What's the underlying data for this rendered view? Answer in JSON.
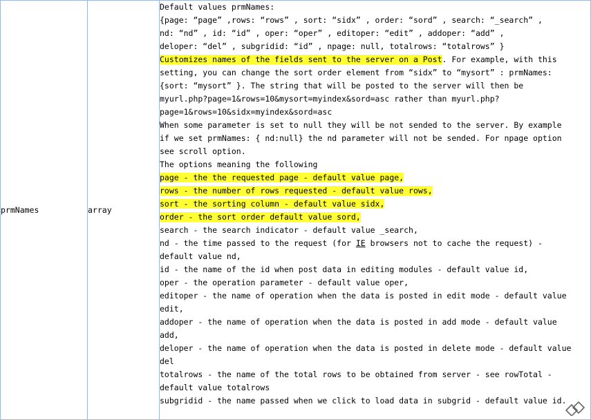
{
  "row": {
    "name": "prmNames",
    "type": "array",
    "description": {
      "default_values": [
        "Default values prmNames:",
        "{page: “page” ,rows: “rows” , sort: “sidx” , order: “sord” , search: “_search” ,",
        "nd: “nd” , id: “id” , oper: “oper” , editoper: “edit” , addoper: “add” ,",
        "deloper: “del” , subgridid: “id” , npage: null, totalrows: “totalrows” }"
      ],
      "customize_highlight": "Customizes names of the fields sent to the server on a Post",
      "customize_rest": ". For example, with this",
      "explain_lines": [
        "setting, you can change the sort order element from  “sidx”  to  “mysort” : prmNames:",
        "{sort:  “mysort” }. The string that will be posted to the server will then be",
        "myurl.php?page=1&rows=10&mysort=myindex&sord=asc rather than myurl.php?",
        "page=1&rows=10&sidx=myindex&sord=asc",
        "When some parameter is set to null they will be not sended to the server. By example",
        "if we set prmNames: { nd:null} the nd parameter will not be sended. For npage option",
        "see scroll option.",
        "The options meaning the following"
      ],
      "highlighted_options": [
        "page - the the requested page - default value page,",
        "rows - the number of rows requested - default value rows,",
        "sort - the sorting column - default value sidx,",
        "order - the sort order default value sord,"
      ],
      "search_line": "search - the search indicator - default value _search,",
      "nd_before": "nd - the time passed to the request (for ",
      "nd_ie": "IE",
      "nd_after": " browsers not to cache the request) -",
      "other_options": [
        "default value nd,",
        "id - the name of the id when post data in editing modules - default value id,",
        "oper - the operation parameter - default value oper,",
        "editoper - the name of operation when the data is posted in edit mode - default value",
        "edit,",
        "addoper - the name of operation when the data is posted in add mode - default value",
        "add,",
        "deloper - the name of operation when the data is posted in delete mode - default value",
        "del",
        "totalrows - the name of the total rows to be obtained from server - see rowTotal -",
        "default value totalrows",
        "subgridid - the name passed when we click to load data in subgrid - default value id."
      ]
    }
  },
  "colors": {
    "highlight": "#ffff33",
    "border": "#9fb6d3"
  },
  "icons": {
    "corner": "watermark-logo-icon"
  }
}
